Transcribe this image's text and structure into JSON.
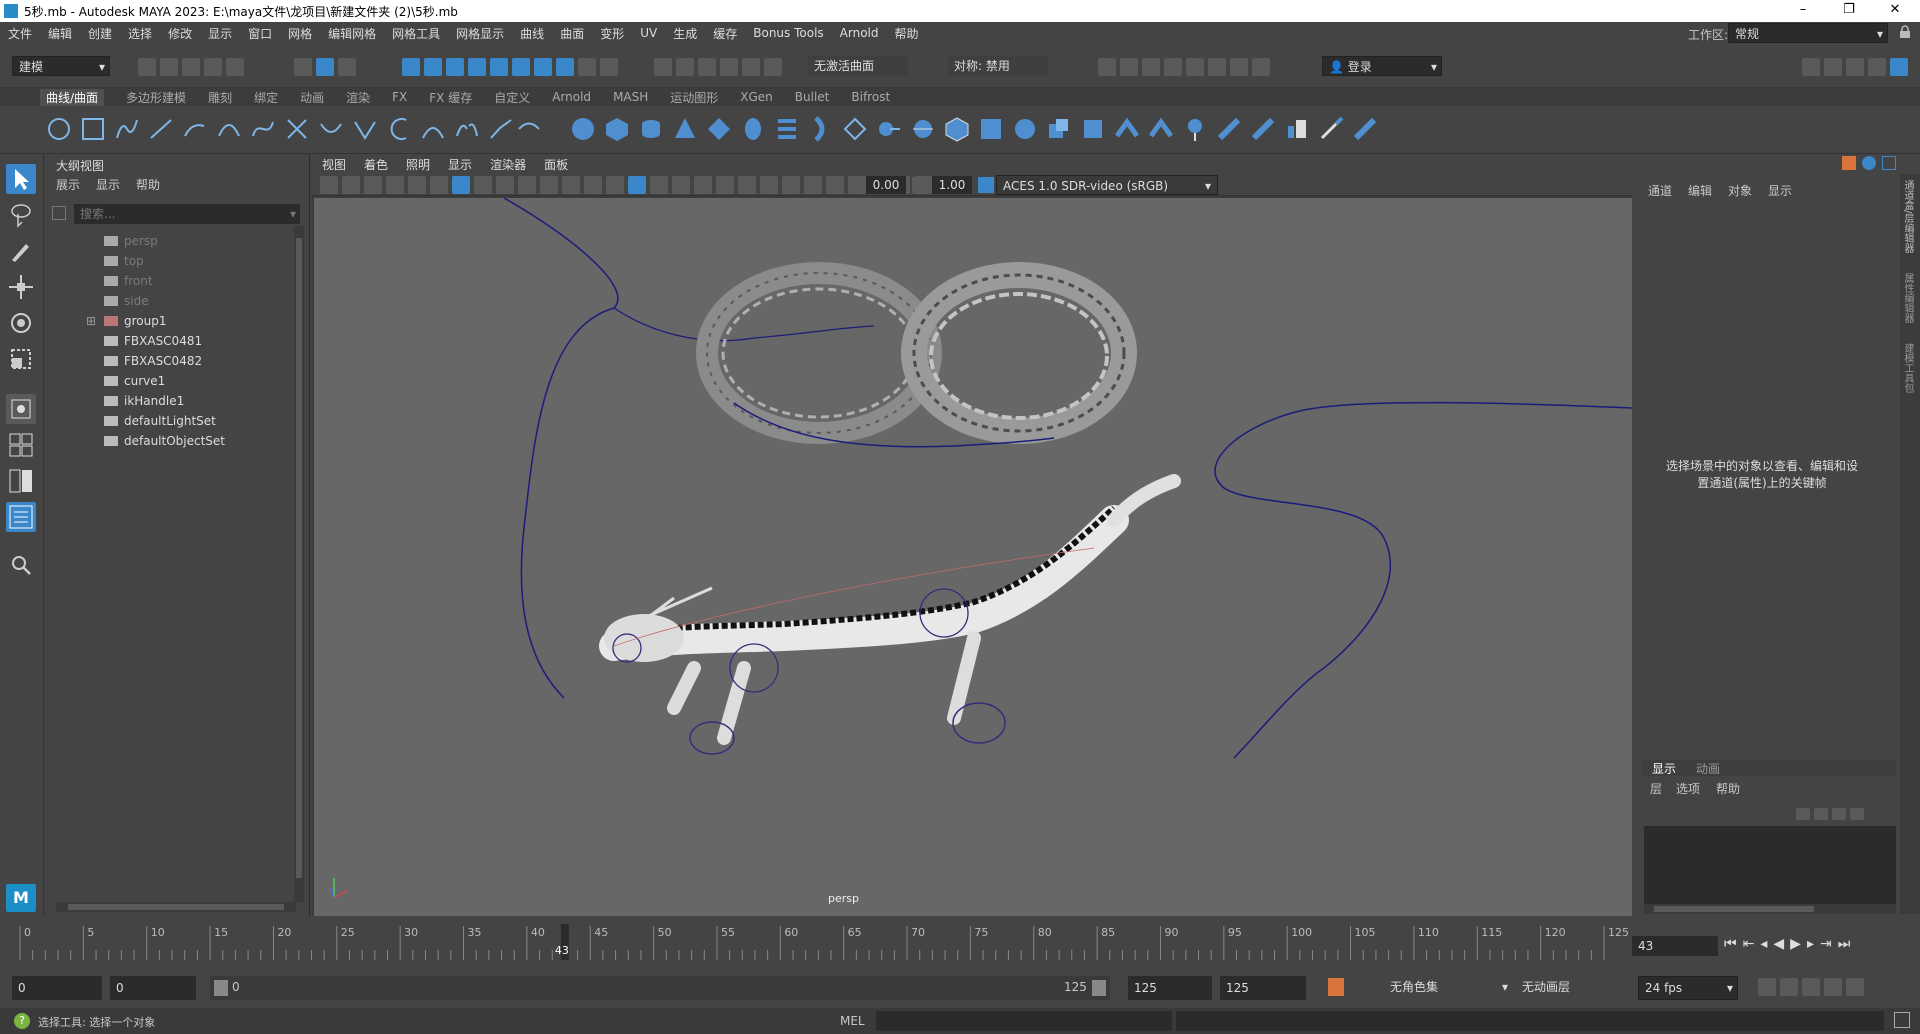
{
  "window": {
    "title": "5秒.mb - Autodesk MAYA 2023: E:\\maya文件\\龙项目\\新建文件夹 (2)\\5秒.mb",
    "minimize": "–",
    "restore": "❐",
    "close": "✕"
  },
  "menubar": {
    "items": [
      "文件",
      "编辑",
      "创建",
      "选择",
      "修改",
      "显示",
      "窗口",
      "网格",
      "编辑网格",
      "网格工具",
      "网格显示",
      "曲线",
      "曲面",
      "变形",
      "UV",
      "生成",
      "缓存",
      "Bonus Tools",
      "Arnold",
      "帮助"
    ],
    "workspace_label": "工作区:",
    "workspace_value": "常规"
  },
  "statusline": {
    "mode": "建模",
    "no_live_surface": "无激活曲面",
    "symmetry": "对称: 禁用",
    "login": "登录"
  },
  "shelf": {
    "tabs": [
      "曲线/曲面",
      "多边形建模",
      "雕刻",
      "绑定",
      "动画",
      "渲染",
      "FX",
      "FX 缓存",
      "自定义",
      "Arnold",
      "MASH",
      "运动图形",
      "XGen",
      "Bullet",
      "Bifrost"
    ],
    "active_tab": 0
  },
  "outliner": {
    "title": "大纲视图",
    "menu": [
      "展示",
      "显示",
      "帮助"
    ],
    "search_placeholder": "搜索...",
    "items": [
      {
        "label": "persp",
        "icon": "camera-icon",
        "dim": true
      },
      {
        "label": "top",
        "icon": "camera-icon",
        "dim": true
      },
      {
        "label": "front",
        "icon": "camera-icon",
        "dim": true
      },
      {
        "label": "side",
        "icon": "camera-icon",
        "dim": true
      },
      {
        "label": "group1",
        "icon": "group-icon",
        "dim": false
      },
      {
        "label": "FBXASC0481",
        "icon": "mesh-icon",
        "dim": false
      },
      {
        "label": "FBXASC0482",
        "icon": "mesh-icon",
        "dim": false
      },
      {
        "label": "curve1",
        "icon": "curve-icon",
        "dim": false
      },
      {
        "label": "ikHandle1",
        "icon": "ik-handle-icon",
        "dim": false
      },
      {
        "label": "defaultLightSet",
        "icon": "set-icon",
        "dim": false
      },
      {
        "label": "defaultObjectSet",
        "icon": "set-icon",
        "dim": false
      }
    ]
  },
  "viewport": {
    "menu": [
      "视图",
      "着色",
      "照明",
      "显示",
      "渲染器",
      "面板"
    ],
    "exposure": "0.00",
    "gamma": "1.00",
    "colorspace": "ACES 1.0 SDR-video (sRGB)",
    "camera_label": "persp"
  },
  "channelbox": {
    "menu": [
      "通道",
      "编辑",
      "对象",
      "显示"
    ],
    "hint": "选择场景中的对象以查看、编辑和设置通道(属性)上的关键帧",
    "layer_tabs": [
      "显示",
      "动画"
    ],
    "layer_menu": [
      "层",
      "选项",
      "帮助"
    ],
    "side_tabs": [
      "通道盒/层编辑器",
      "属性编辑器",
      "建模工具包"
    ]
  },
  "timeline": {
    "ticks": [
      0,
      5,
      10,
      15,
      20,
      25,
      30,
      35,
      40,
      45,
      50,
      55,
      60,
      65,
      70,
      75,
      80,
      85,
      90,
      95,
      100,
      105,
      110,
      115,
      120,
      125
    ],
    "current_frame": "43",
    "current_frame_field": "43"
  },
  "range": {
    "start": "0",
    "anim_start": "0",
    "slider_start": "0",
    "slider_end": "125",
    "anim_end": "125",
    "end": "125",
    "character_set": "无角色集",
    "anim_layer": "无动画层",
    "fps": "24 fps"
  },
  "commandline": {
    "help_text": "选择工具: 选择一个对象",
    "lang": "MEL"
  },
  "colors": {
    "curve": "#1c1c7a",
    "viewport_bg": "#676767",
    "accent": "#3a87c9"
  }
}
